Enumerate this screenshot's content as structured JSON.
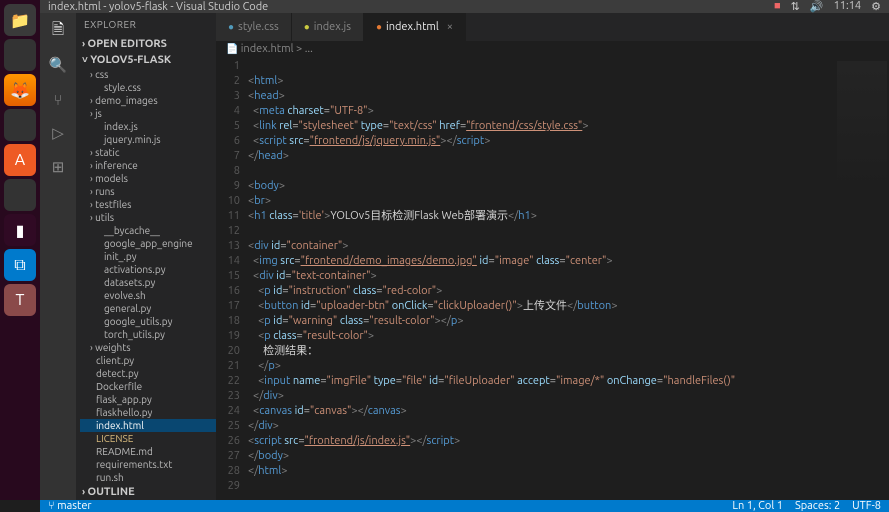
{
  "titlebar": {
    "title": "index.html - yolov5-flask - Visual Studio Code",
    "time": "11:14"
  },
  "activity": [
    "files",
    "search",
    "git",
    "debug",
    "ext"
  ],
  "sidebar": {
    "header": "EXPLORER",
    "section1": "OPEN EDITORS",
    "section2": "YOLOV5-FLASK",
    "tree": [
      {
        "label": "css",
        "cls": "folder"
      },
      {
        "label": "style.css",
        "cls": "lvl2"
      },
      {
        "label": "demo_images",
        "cls": "folder"
      },
      {
        "label": "js",
        "cls": "folder"
      },
      {
        "label": "index.js",
        "cls": "lvl2"
      },
      {
        "label": "jquery.min.js",
        "cls": "lvl2"
      },
      {
        "label": "static",
        "cls": "folder"
      },
      {
        "label": "inference",
        "cls": "folder"
      },
      {
        "label": "models",
        "cls": "folder"
      },
      {
        "label": "runs",
        "cls": "folder"
      },
      {
        "label": "testfiles",
        "cls": "folder"
      },
      {
        "label": "utils",
        "cls": "folder"
      },
      {
        "label": "__bycache__",
        "cls": "lvl2"
      },
      {
        "label": "google_app_engine",
        "cls": "lvl2"
      },
      {
        "label": "init_.py",
        "cls": "lvl2"
      },
      {
        "label": "activations.py",
        "cls": "lvl2"
      },
      {
        "label": "datasets.py",
        "cls": "lvl2"
      },
      {
        "label": "evolve.sh",
        "cls": "lvl2"
      },
      {
        "label": "general.py",
        "cls": "lvl2"
      },
      {
        "label": "google_utils.py",
        "cls": "lvl2"
      },
      {
        "label": "torch_utils.py",
        "cls": "lvl2"
      },
      {
        "label": "weights",
        "cls": "folder"
      },
      {
        "label": "client.py",
        "cls": ""
      },
      {
        "label": "detect.py",
        "cls": ""
      },
      {
        "label": "Dockerfile",
        "cls": ""
      },
      {
        "label": "flask_app.py",
        "cls": ""
      },
      {
        "label": "flaskhello.py",
        "cls": ""
      },
      {
        "label": "index.html",
        "cls": "active"
      },
      {
        "label": "LICENSE",
        "cls": "yellow"
      },
      {
        "label": "README.md",
        "cls": ""
      },
      {
        "label": "requirements.txt",
        "cls": ""
      },
      {
        "label": "run.sh",
        "cls": ""
      }
    ],
    "outline": "OUTLINE"
  },
  "tabs": [
    {
      "label": "style.css",
      "icon": "css",
      "active": false
    },
    {
      "label": "index.js",
      "icon": "js",
      "active": false
    },
    {
      "label": "index.html",
      "icon": "html",
      "active": true
    }
  ],
  "breadcrumb": "index.html > ...",
  "code_lines": [
    "",
    "<span class='p'>&lt;</span><span class='t'>html</span><span class='p'>&gt;</span>",
    "<span class='p'>&lt;</span><span class='t'>head</span><span class='p'>&gt;</span>",
    "  <span class='p'>&lt;</span><span class='t'>meta</span> <span class='a'>charset</span>=<span class='s'>\"UTF-8\"</span><span class='p'>&gt;</span>",
    "  <span class='p'>&lt;</span><span class='t'>link</span> <span class='a'>rel</span>=<span class='s'>\"stylesheet\"</span> <span class='a'>type</span>=<span class='s'>\"text/css\"</span> <span class='a'>href</span>=<span class='su'>\"frontend/css/style.css\"</span><span class='p'>&gt;</span>",
    "  <span class='p'>&lt;</span><span class='t'>script</span> <span class='a'>src</span>=<span class='su'>\"frontend/js/jquery.min.js\"</span><span class='p'>&gt;&lt;/</span><span class='t'>script</span><span class='p'>&gt;</span>",
    "<span class='p'>&lt;/</span><span class='t'>head</span><span class='p'>&gt;</span>",
    "",
    "<span class='p'>&lt;</span><span class='t'>body</span><span class='p'>&gt;</span>",
    "<span class='p'>&lt;</span><span class='t'>br</span><span class='p'>&gt;</span>",
    "<span class='p'>&lt;</span><span class='t'>h1</span> <span class='a'>class</span>=<span class='s'>'title'</span><span class='p'>&gt;</span><span class='tx'>YOLOv5目标检测Flask Web部署演示</span><span class='p'>&lt;/</span><span class='t'>h1</span><span class='p'>&gt;</span>",
    "",
    "<span class='p'>&lt;</span><span class='t'>div</span> <span class='a'>id</span>=<span class='s'>\"container\"</span><span class='p'>&gt;</span>",
    "  <span class='p'>&lt;</span><span class='t'>img</span> <span class='a'>src</span>=<span class='su'>\"frontend/demo_images/demo.jpg\"</span> <span class='a'>id</span>=<span class='s'>\"image\"</span> <span class='a'>class</span>=<span class='s'>\"center\"</span><span class='p'>&gt;</span>",
    "  <span class='p'>&lt;</span><span class='t'>div</span> <span class='a'>id</span>=<span class='s'>\"text-container\"</span><span class='p'>&gt;</span>",
    "    <span class='p'>&lt;</span><span class='t'>p</span> <span class='a'>id</span>=<span class='s'>\"instruction\"</span> <span class='a'>class</span>=<span class='s'>\"red-color\"</span><span class='p'>&gt;</span>",
    "    <span class='p'>&lt;</span><span class='t'>button</span> <span class='a'>id</span>=<span class='s'>\"uploader-btn\"</span> <span class='a'>onClick</span>=<span class='s'>\"clickUploader()\"</span><span class='p'>&gt;</span><span class='tx'>上传文件</span><span class='p'>&lt;/</span><span class='t'>button</span><span class='p'>&gt;</span>",
    "    <span class='p'>&lt;</span><span class='t'>p</span> <span class='a'>id</span>=<span class='s'>\"warning\"</span> <span class='a'>class</span>=<span class='s'>\"result-color\"</span><span class='p'>&gt;&lt;/</span><span class='t'>p</span><span class='p'>&gt;</span>",
    "    <span class='p'>&lt;</span><span class='t'>p</span> <span class='a'>class</span>=<span class='s'>\"result-color\"</span><span class='p'>&gt;</span>",
    "      <span class='tx'>检测结果：</span>",
    "    <span class='p'>&lt;/</span><span class='t'>p</span><span class='p'>&gt;</span>",
    "    <span class='p'>&lt;</span><span class='t'>input</span> <span class='a'>name</span>=<span class='s'>\"imgFile\"</span> <span class='a'>type</span>=<span class='s'>\"file\"</span> <span class='a'>id</span>=<span class='s'>\"fileUploader\"</span> <span class='a'>accept</span>=<span class='s'>\"image/*\"</span> <span class='a'>onChange</span>=<span class='s'>\"handleFiles()\"</span>",
    "  <span class='p'>&lt;/</span><span class='t'>div</span><span class='p'>&gt;</span>",
    "  <span class='p'>&lt;</span><span class='t'>canvas</span> <span class='a'>id</span>=<span class='s'>\"canvas\"</span><span class='p'>&gt;&lt;/</span><span class='t'>canvas</span><span class='p'>&gt;</span>",
    "<span class='p'>&lt;/</span><span class='t'>div</span><span class='p'>&gt;</span>",
    "<span class='p'>&lt;</span><span class='t'>script</span> <span class='a'>src</span>=<span class='su'>\"frontend/js/index.js\"</span><span class='p'>&gt;&lt;/</span><span class='t'>script</span><span class='p'>&gt;</span>",
    "<span class='p'>&lt;/</span><span class='t'>body</span><span class='p'>&gt;</span>",
    "<span class='p'>&lt;/</span><span class='t'>html</span><span class='p'>&gt;</span>",
    ""
  ],
  "statusbar": {
    "pos": "Ln 1, Col 1",
    "spaces": "Spaces: 2",
    "enc": "UTF-8"
  }
}
